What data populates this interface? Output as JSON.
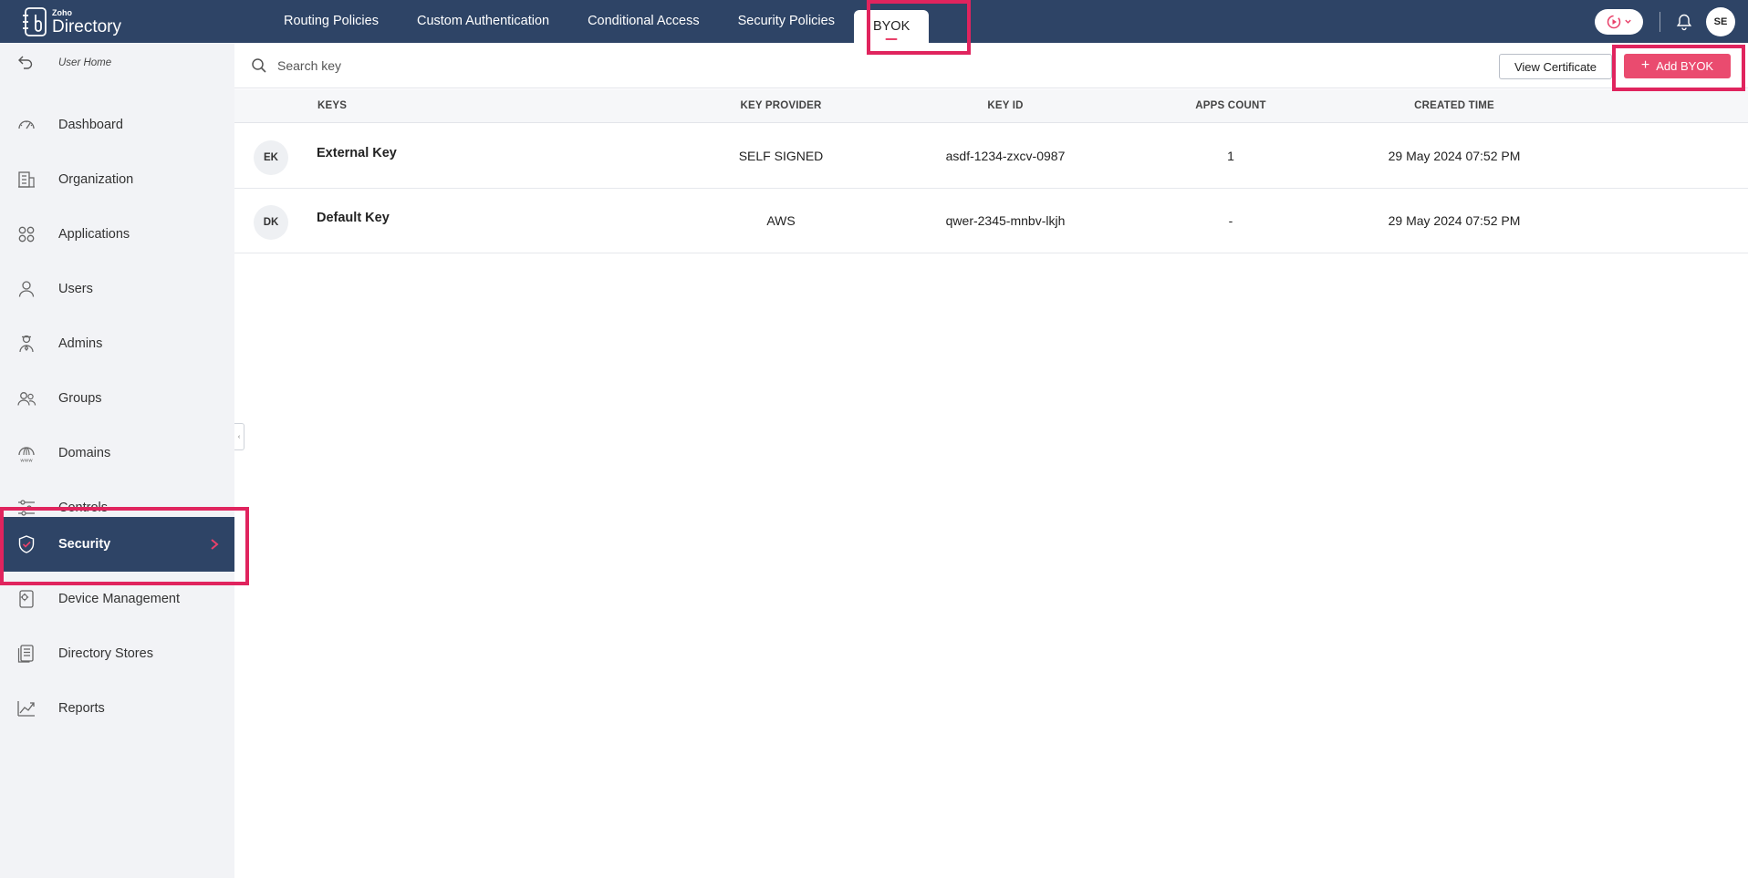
{
  "app": {
    "brand_small": "Zoho",
    "brand_big": "Directory"
  },
  "topnav": {
    "items": [
      {
        "label": "Routing Policies"
      },
      {
        "label": "Custom Authentication"
      },
      {
        "label": "Conditional Access"
      },
      {
        "label": "Security Policies"
      },
      {
        "label": "BYOK"
      }
    ],
    "active": "BYOK"
  },
  "user": {
    "initials": "SE"
  },
  "sidebar": {
    "back_label": "User Home",
    "items": [
      {
        "label": "Dashboard",
        "icon": "dashboard-gauge-icon"
      },
      {
        "label": "Organization",
        "icon": "building-icon"
      },
      {
        "label": "Applications",
        "icon": "apps-grid-icon"
      },
      {
        "label": "Users",
        "icon": "user-icon"
      },
      {
        "label": "Admins",
        "icon": "admin-icon"
      },
      {
        "label": "Groups",
        "icon": "group-icon"
      },
      {
        "label": "Domains",
        "icon": "www-domain-icon"
      },
      {
        "label": "Controls",
        "icon": "sliders-icon"
      },
      {
        "label": "Security",
        "icon": "shield-icon",
        "active": true
      },
      {
        "label": "Device Management",
        "icon": "device-gear-icon"
      },
      {
        "label": "Directory Stores",
        "icon": "directory-store-icon"
      },
      {
        "label": "Reports",
        "icon": "reports-chart-icon"
      }
    ]
  },
  "search": {
    "placeholder": "Search key",
    "value": ""
  },
  "actions": {
    "view_certificate": "View Certificate",
    "add_byok": "Add BYOK"
  },
  "table": {
    "columns": [
      "KEYS",
      "KEY PROVIDER",
      "KEY ID",
      "APPS COUNT",
      "CREATED TIME"
    ],
    "rows": [
      {
        "initials": "EK",
        "name": "External Key",
        "provider": "SELF SIGNED",
        "key_id": "asdf-1234-zxcv-0987",
        "apps_count": "1",
        "created": "29 May 2024 07:52 PM"
      },
      {
        "initials": "DK",
        "name": "Default Key",
        "provider": "AWS",
        "key_id": "qwer-2345-mnbv-lkjh",
        "apps_count": "-",
        "created": "29 May 2024 07:52 PM"
      }
    ]
  },
  "colors": {
    "header_bg": "#2e4466",
    "accent": "#ea4b6f",
    "highlight": "#e0245e"
  }
}
